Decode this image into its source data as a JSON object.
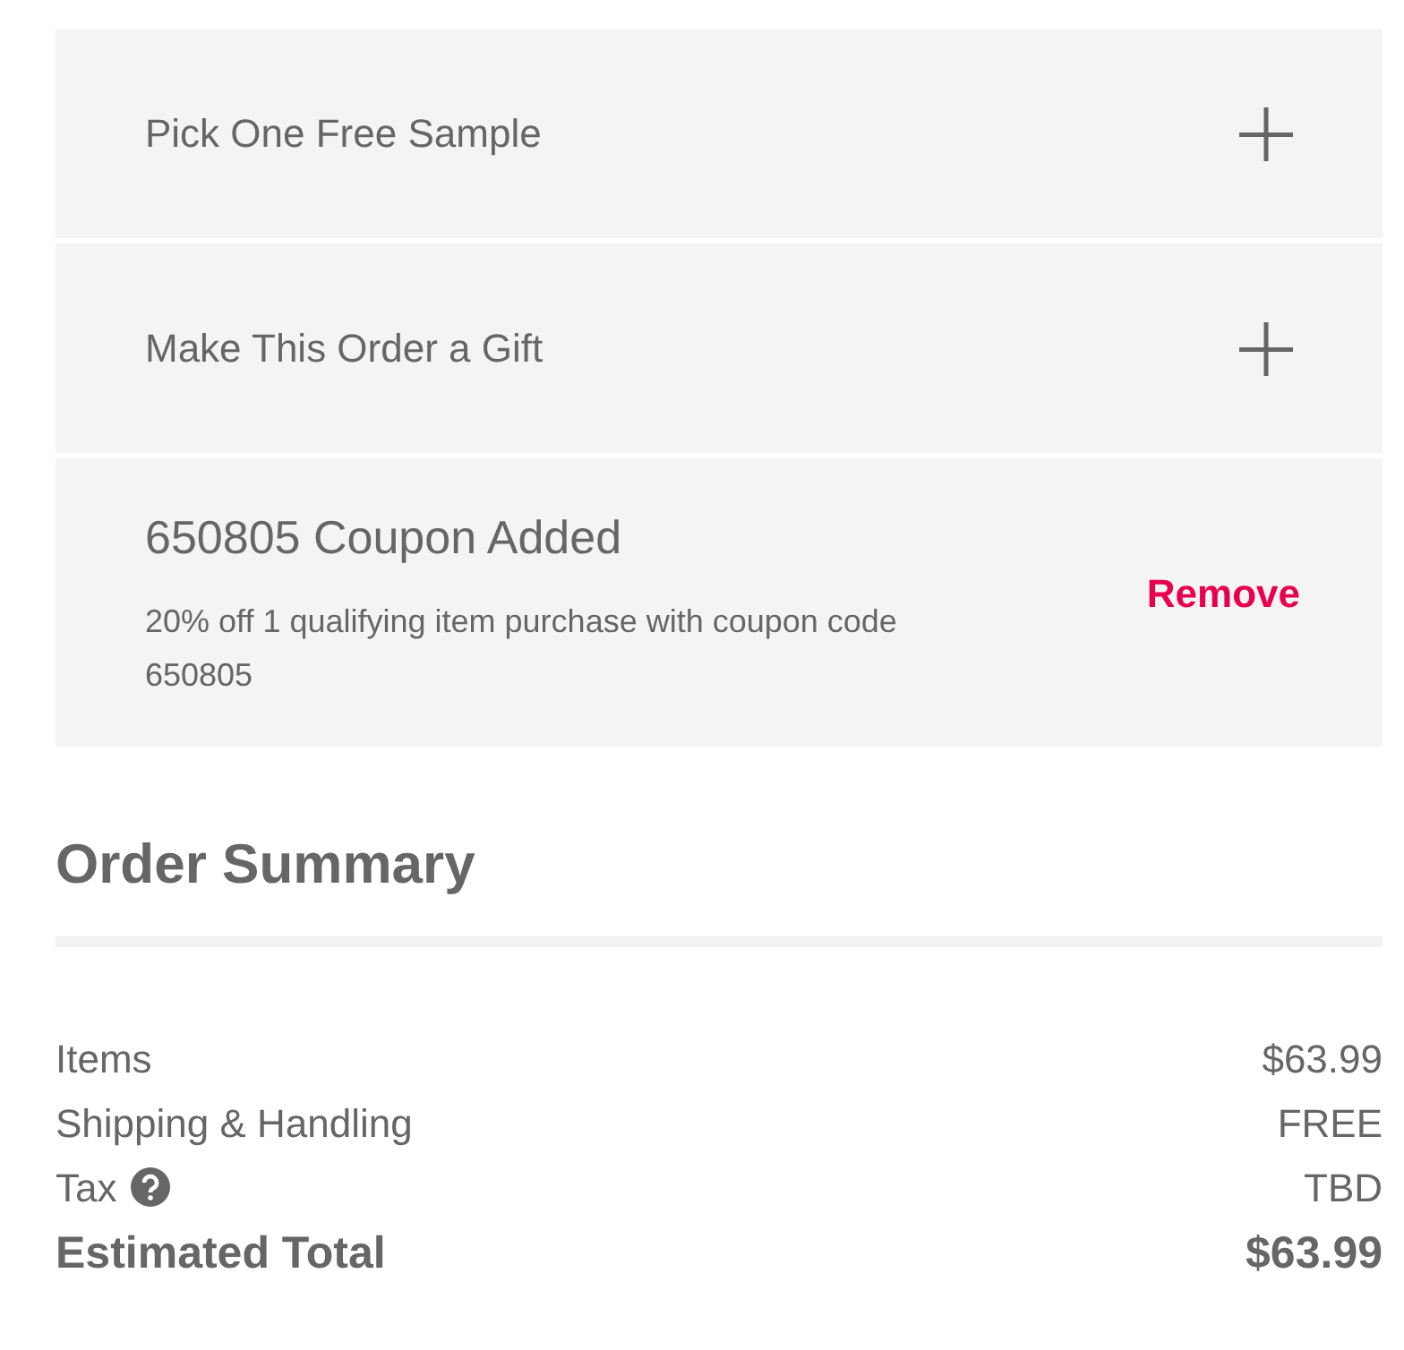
{
  "accordion": [
    {
      "title": "Pick One Free Sample",
      "expanded": false
    },
    {
      "title": "Make This Order a Gift",
      "expanded": false
    }
  ],
  "coupon": {
    "title": "650805 Coupon Added",
    "description": "20% off 1 qualifying item purchase with coupon code 650805",
    "action": "Remove"
  },
  "order_summary": {
    "title": "Order Summary",
    "rows": [
      {
        "kind": "line",
        "label": "Items",
        "value": "$63.99",
        "help": false
      },
      {
        "kind": "line",
        "label": "Shipping & Handling",
        "value": "FREE",
        "help": false
      },
      {
        "kind": "line",
        "label": "Tax",
        "value": "TBD",
        "help": true
      },
      {
        "kind": "total",
        "label": "Estimated Total",
        "value": "$63.99",
        "help": false
      }
    ]
  }
}
